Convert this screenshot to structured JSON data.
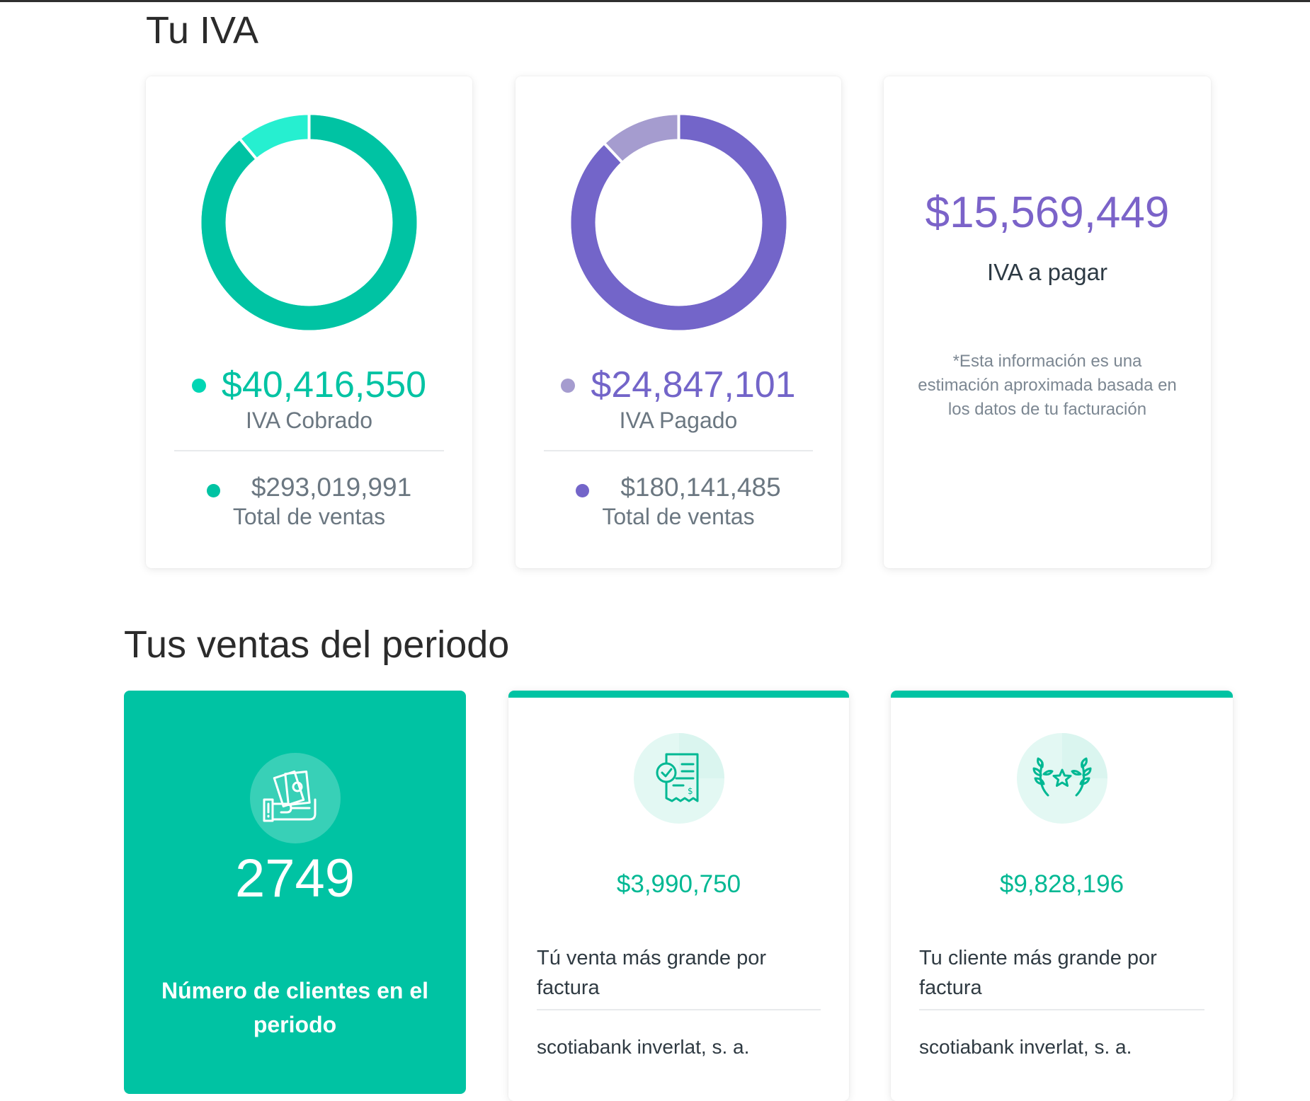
{
  "iva_section": {
    "title": "Tu IVA",
    "cobrado": {
      "amount": "$40,416,550",
      "label": "IVA Cobrado",
      "total_amount": "$293,019,991",
      "total_label": "Total de ventas",
      "donut_fraction": 0.89,
      "main_color": "#00c3a3",
      "secondary_color": "#26efd0"
    },
    "pagado": {
      "amount": "$24,847,101",
      "label": "IVA Pagado",
      "total_amount": "$180,141,485",
      "total_label": "Total de ventas",
      "donut_fraction": 0.88,
      "main_color": "#7365c9",
      "secondary_color": "#a59ccf"
    },
    "a_pagar": {
      "amount": "$15,569,449",
      "label": "IVA a pagar",
      "note": "*Esta información es una estimación aproximada basada en los datos de tu facturación"
    }
  },
  "sales_section": {
    "title": "Tus ventas del periodo",
    "clientes": {
      "count": "2749",
      "label": "Número de clientes en el periodo",
      "icon": "cash-in-hand-icon"
    },
    "venta_mas_grande": {
      "amount": "$3,990,750",
      "description": "Tú venta más grande por factura",
      "client": "scotiabank inverlat, s. a.",
      "icon": "invoice-check-icon"
    },
    "cliente_mas_grande": {
      "amount": "$9,828,196",
      "description": "Tu cliente más grande por factura",
      "client": "scotiabank inverlat, s. a.",
      "icon": "laurel-star-icon"
    }
  },
  "colors": {
    "accent_green": "#00c3a3",
    "accent_purple": "#7b63c9"
  }
}
